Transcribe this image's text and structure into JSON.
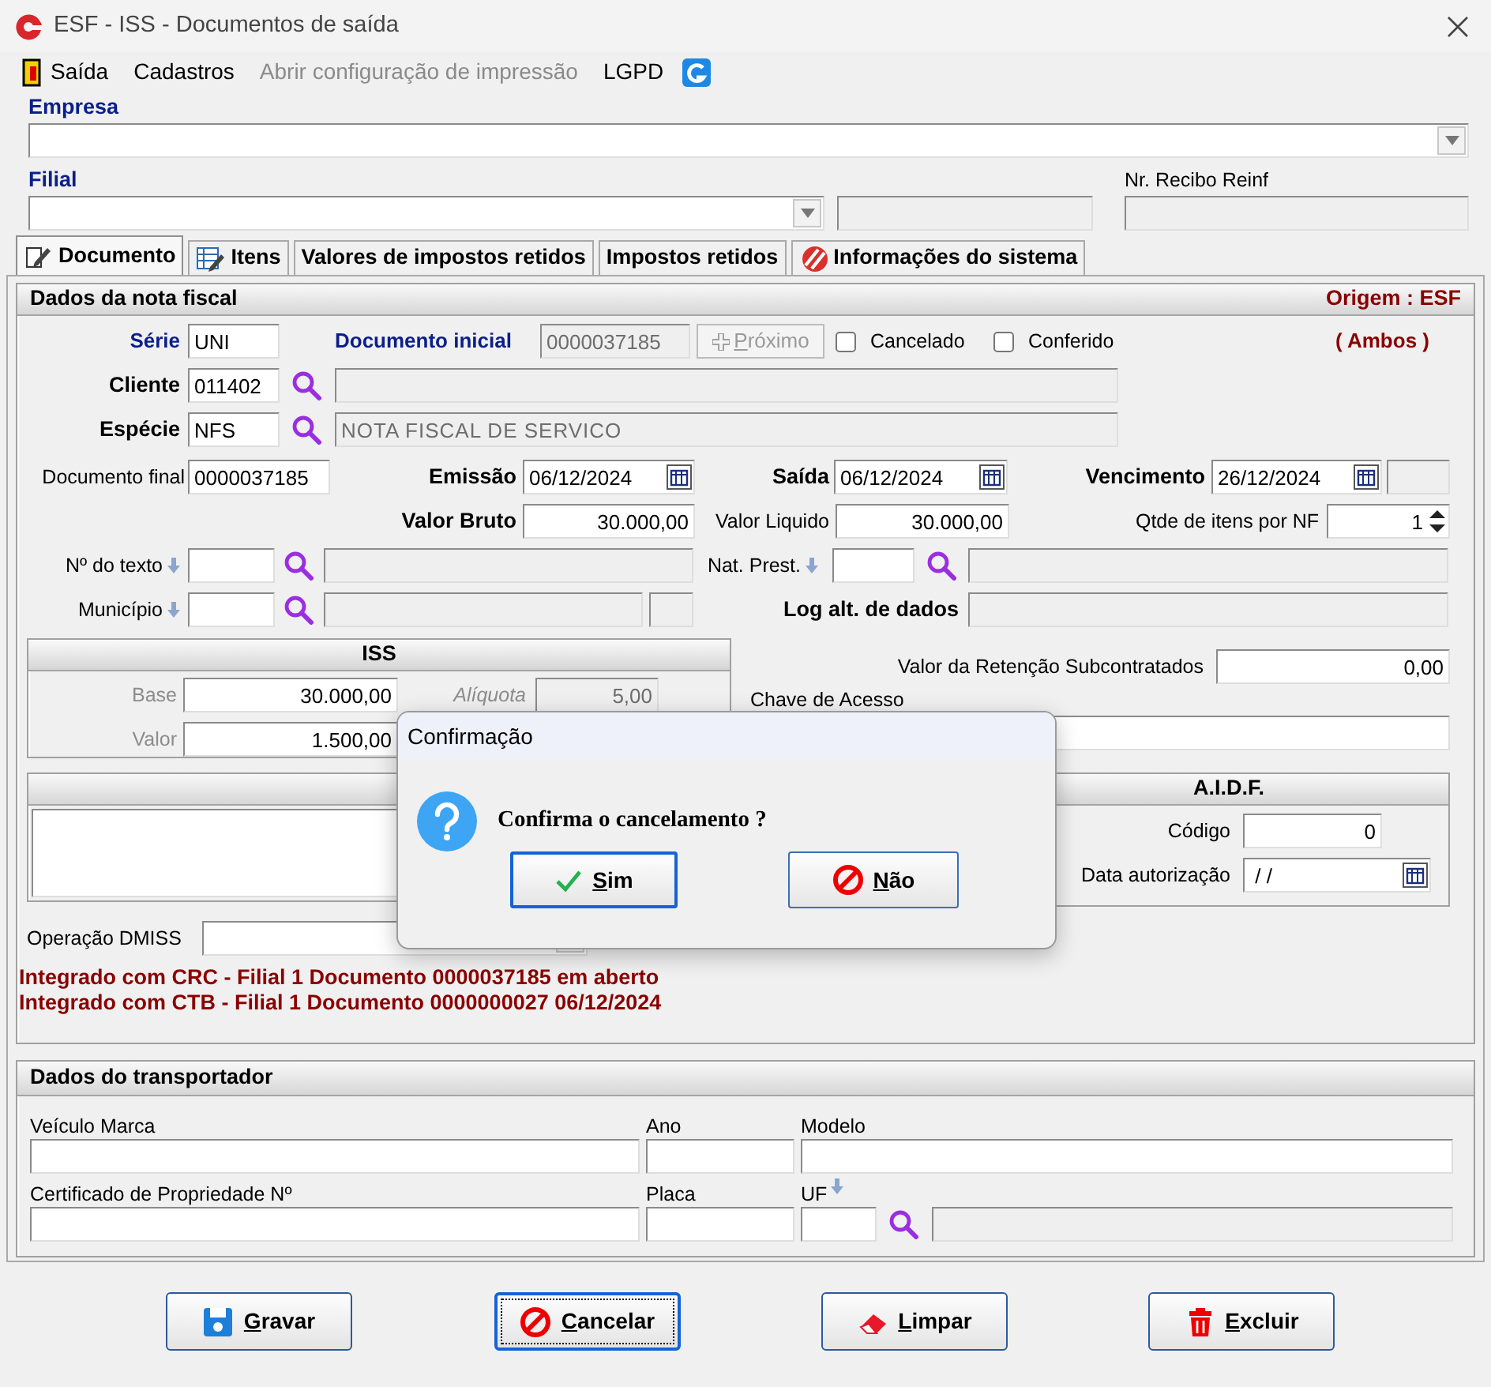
{
  "window": {
    "title": "ESF - ISS - Documentos de saída"
  },
  "menu": [
    {
      "label": "Saída",
      "disabled": false
    },
    {
      "label": "Cadastros",
      "disabled": false
    },
    {
      "label": "Abrir configuração de impressão",
      "disabled": true
    },
    {
      "label": "LGPD",
      "disabled": false
    }
  ],
  "company": {
    "empresa_label": "Empresa",
    "filial_label": "Filial",
    "recibo_label": "Nr. Recibo Reinf"
  },
  "tabs": [
    {
      "label": "Documento",
      "kind": "document",
      "selected": true
    },
    {
      "label": "Itens",
      "kind": "items",
      "selected": false
    },
    {
      "label": "Valores de impostos retidos",
      "kind": "plain",
      "selected": false
    },
    {
      "label": "Impostos retidos",
      "kind": "plain",
      "selected": false
    },
    {
      "label": "Informações do sistema",
      "kind": "info",
      "selected": false
    }
  ],
  "invoice": {
    "title": "Dados da nota fiscal",
    "origin": "Origem : ESF",
    "scope": "( Ambos )",
    "serie_label": "Série",
    "serie": "UNI",
    "doc_initial_label": "Documento inicial",
    "doc_initial": "0000037185",
    "next_button": {
      "label": "Próximo",
      "disabled": true
    },
    "checks": [
      {
        "label": "Cancelado",
        "checked": false
      },
      {
        "label": "Conferido",
        "checked": false
      }
    ],
    "client_label": "Cliente",
    "client_code": "011402",
    "species_label": "Espécie",
    "species_code": "NFS",
    "species_name": "NOTA FISCAL DE SERVICO",
    "doc_final_label": "Documento final",
    "doc_final": "0000037185",
    "emission_label": "Emissão",
    "emission": "06/12/2024",
    "exit_label": "Saída",
    "exit": "06/12/2024",
    "due_label": "Vencimento",
    "due": "26/12/2024",
    "gross_label": "Valor Bruto",
    "gross": "30.000,00",
    "net_label": "Valor Liquido",
    "net": "30.000,00",
    "items_label": "Qtde de itens por NF",
    "items": "1",
    "text_label": "Nº do texto",
    "nat_label": "Nat. Prest.",
    "city_label": "Município",
    "log_label": "Log alt. de dados"
  },
  "iss": {
    "title": "ISS",
    "base_label": "Base",
    "base": "30.000,00",
    "rate_label": "Alíquota",
    "rate": "5,00",
    "value_label": "Valor",
    "value": "1.500,00"
  },
  "retention": {
    "label": "Valor da Retenção Subcontratados",
    "value": "0,00",
    "key_label": "Chave de Acesso"
  },
  "aidf": {
    "title": "A.I.D.F.",
    "code_label": "Código",
    "code": "0",
    "date_label": "Data autorização",
    "date": " / /"
  },
  "dmiss_label": "Operação DMISS",
  "integrations": [
    "Integrado com CRC - Filial 1 Documento 0000037185 em aberto",
    "Integrado com CTB - Filial 1 Documento 0000000027 06/12/2024"
  ],
  "carrier": {
    "title": "Dados do transportador",
    "brand_label": "Veículo Marca",
    "year_label": "Ano",
    "model_label": "Modelo",
    "cert_label": "Certificado de Propriedade Nº",
    "plate_label": "Placa",
    "uf_label": "UF"
  },
  "actions": [
    {
      "label": "Gravar",
      "kind": "save",
      "focused": false
    },
    {
      "label": "Cancelar",
      "kind": "cancel",
      "focused": true
    },
    {
      "label": "Limpar",
      "kind": "clear",
      "focused": false
    },
    {
      "label": "Excluir",
      "kind": "delete",
      "focused": false
    }
  ],
  "dialog": {
    "title": "Confirmação",
    "message": "Confirma o cancelamento ?",
    "buttons": [
      {
        "label": "Sim",
        "kind": "yes",
        "focused": true
      },
      {
        "label": "Não",
        "kind": "no",
        "focused": false
      }
    ]
  }
}
